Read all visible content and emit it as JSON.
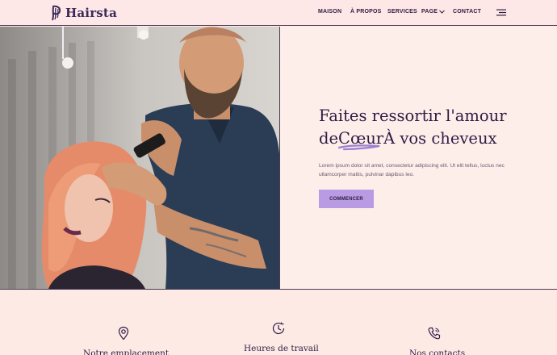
{
  "brand": {
    "name": "Hairsta",
    "logo_icon": "hair-strands-icon"
  },
  "nav": {
    "items": [
      {
        "label": "MAISON"
      },
      {
        "label": "À PROPOS"
      },
      {
        "label": "SERVICES"
      },
      {
        "label": "PAGE",
        "dropdown_icon": "chevron-down-icon"
      },
      {
        "label": "CONTACT"
      }
    ],
    "menu_icon": "hamburger-menu-icon"
  },
  "hero": {
    "image_alt": "hairdresser-styling-pink-hair-photo",
    "title_line1": "Faites ressortir l'amour",
    "title_line2_a": "de",
    "title_line2_b": "Cœur",
    "title_line2_c": "À vos cheveux",
    "description": "Lorem ipsum dolor sit amet, consectetur adipiscing elit. Ut elit tellus, luctus nec ullamcorper mattis, pulvinar dapibus leo.",
    "cta_label": "COMMENCER"
  },
  "info": [
    {
      "icon": "location-pin-icon",
      "label": "Notre emplacement"
    },
    {
      "icon": "clock-icon",
      "label": "Heures de travail"
    },
    {
      "icon": "phone-icon",
      "label": "Nos contacts"
    }
  ],
  "colors": {
    "accent": "#b99be3",
    "header_bg": "#fde7e7",
    "page_bg": "#fdeee9",
    "heading": "#2e1c46"
  }
}
